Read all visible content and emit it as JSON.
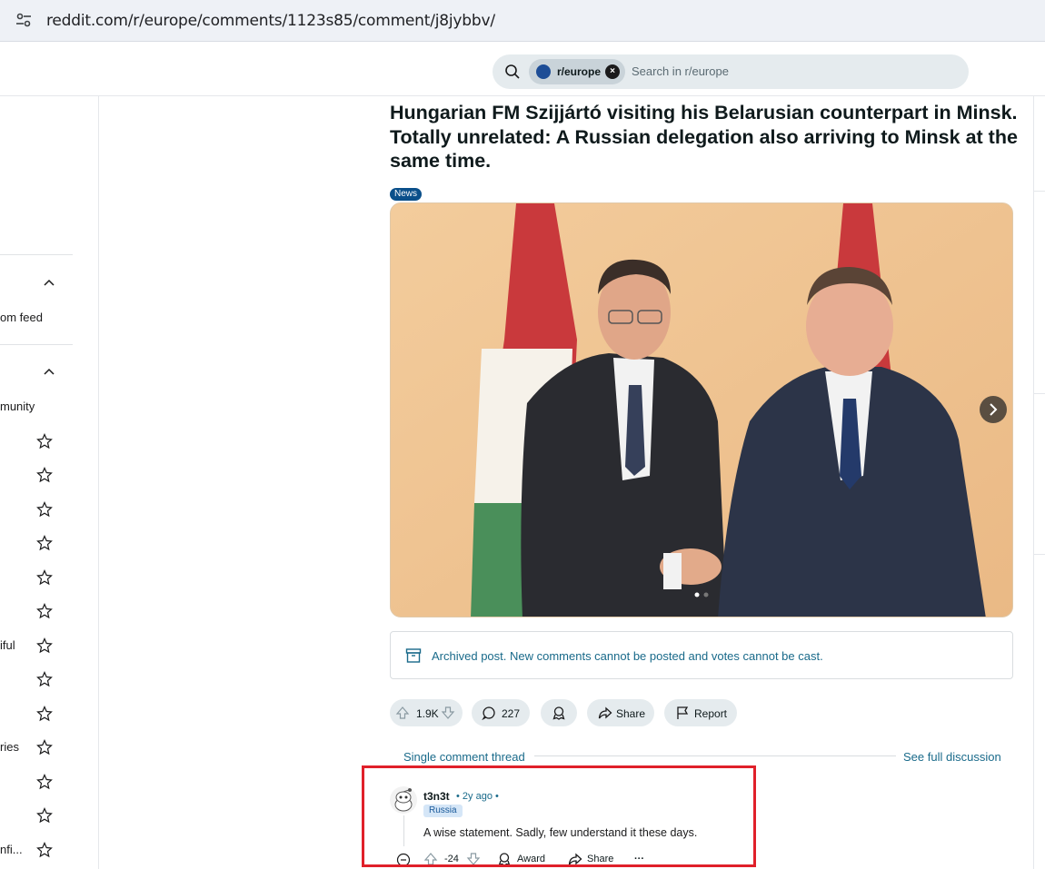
{
  "browser": {
    "url": "reddit.com/r/europe/comments/1123s85/comment/j8jybbv/"
  },
  "header": {
    "search_chip": "r/europe",
    "search_placeholder": "Search in r/europe"
  },
  "sidebar": {
    "items": [
      {
        "label": "om feed"
      },
      {
        "label": "munity"
      },
      {
        "label": "iful"
      },
      {
        "label": "ries"
      },
      {
        "label": "nfi..."
      }
    ]
  },
  "post": {
    "title": "Hungarian FM Szijjártó visiting his Belarusian counterpart in Minsk. Totally unrelated: A Russian delegation also arriving to Minsk at the same time.",
    "flair": "News",
    "archived_notice": "Archived post. New comments cannot be posted and votes cannot be cast.",
    "votes": "1.9K",
    "comments": "227",
    "share_label": "Share",
    "report_label": "Report"
  },
  "thread": {
    "single_label": "Single comment thread",
    "full_label": "See full discussion"
  },
  "comment": {
    "username": "t3n3t",
    "meta": "• 2y ago •",
    "flair": "Russia",
    "body": "A wise statement. Sadly, few understand it these days.",
    "score": "-24",
    "award_label": "Award",
    "share_label": "Share",
    "more_label": "···"
  },
  "colors": {
    "link_blue": "#196a8a",
    "flair_blue": "#0a4f8a",
    "highlight_red": "#e0202a"
  }
}
